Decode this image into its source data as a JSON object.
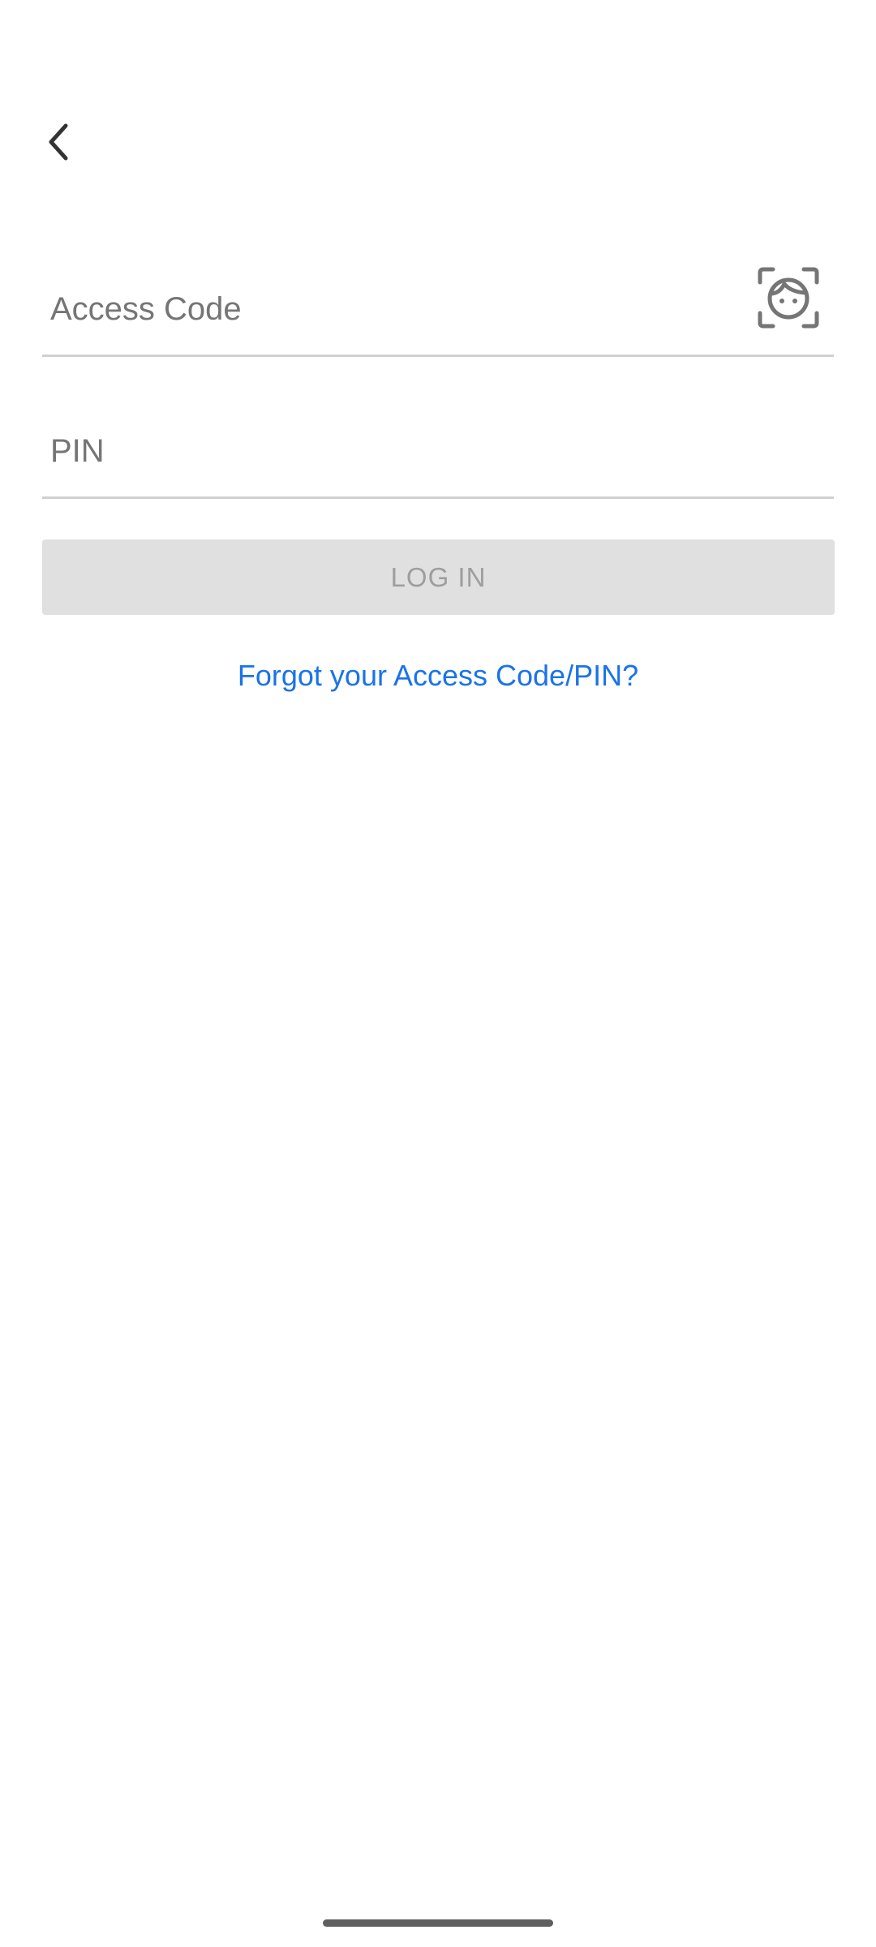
{
  "header": {
    "back_icon": "chevron-left-icon"
  },
  "form": {
    "access_code": {
      "value": "",
      "placeholder": "Access Code",
      "face_id_icon": "face-scan-icon"
    },
    "pin": {
      "value": "",
      "placeholder": "PIN"
    },
    "login_label": "LOG IN",
    "forgot_link": "Forgot your Access Code/PIN?"
  },
  "colors": {
    "link": "#1a73e8",
    "button_disabled_bg": "#e0e0e0",
    "button_disabled_text": "#9e9e9e",
    "divider": "#d0d0d0"
  }
}
